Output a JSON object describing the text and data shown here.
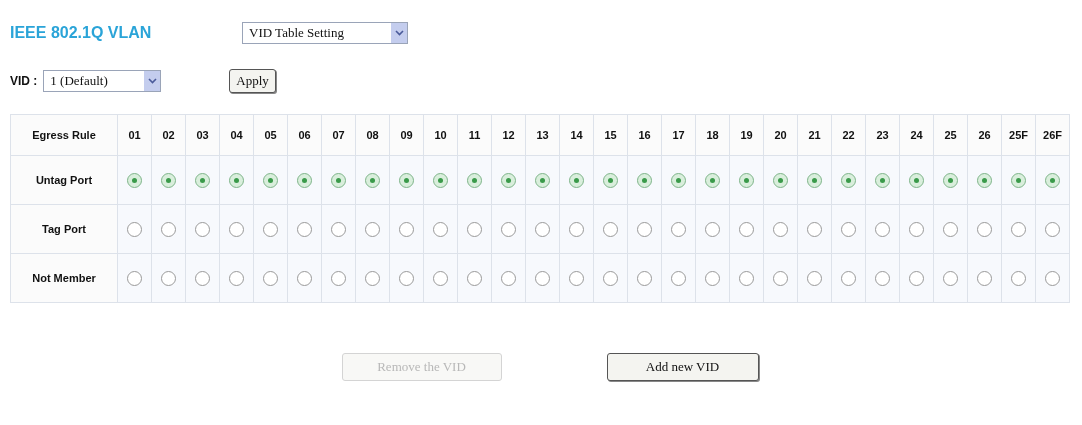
{
  "title": "IEEE 802.1Q VLAN",
  "mode_select": {
    "value": "VID Table Setting"
  },
  "vid": {
    "label": "VID :",
    "value": "1 (Default)"
  },
  "apply_button": {
    "label": "Apply"
  },
  "table": {
    "corner": "Egress Rule",
    "ports": [
      "01",
      "02",
      "03",
      "04",
      "05",
      "06",
      "07",
      "08",
      "09",
      "10",
      "11",
      "12",
      "13",
      "14",
      "15",
      "16",
      "17",
      "18",
      "19",
      "20",
      "21",
      "22",
      "23",
      "24",
      "25",
      "26",
      "25F",
      "26F"
    ],
    "rows": [
      {
        "label": "Untag Port",
        "cells": [
          {
            "selected": true
          },
          {
            "selected": true
          },
          {
            "selected": true
          },
          {
            "selected": true
          },
          {
            "selected": true
          },
          {
            "selected": true
          },
          {
            "selected": true
          },
          {
            "selected": true
          },
          {
            "selected": true
          },
          {
            "selected": true
          },
          {
            "selected": true
          },
          {
            "selected": true
          },
          {
            "selected": true
          },
          {
            "selected": true
          },
          {
            "selected": true
          },
          {
            "selected": true
          },
          {
            "selected": true
          },
          {
            "selected": true
          },
          {
            "selected": true
          },
          {
            "selected": true
          },
          {
            "selected": true
          },
          {
            "selected": true
          },
          {
            "selected": true
          },
          {
            "selected": true
          },
          {
            "selected": true
          },
          {
            "selected": true
          },
          {
            "selected": true
          },
          {
            "selected": true
          }
        ]
      },
      {
        "label": "Tag Port",
        "cells": [
          {
            "selected": false
          },
          {
            "selected": false
          },
          {
            "selected": false
          },
          {
            "selected": false
          },
          {
            "selected": false
          },
          {
            "selected": false
          },
          {
            "selected": false
          },
          {
            "selected": false
          },
          {
            "selected": false
          },
          {
            "selected": false
          },
          {
            "selected": false
          },
          {
            "selected": false
          },
          {
            "selected": false
          },
          {
            "selected": false
          },
          {
            "selected": false
          },
          {
            "selected": false
          },
          {
            "selected": false
          },
          {
            "selected": false
          },
          {
            "selected": false
          },
          {
            "selected": false
          },
          {
            "selected": false
          },
          {
            "selected": false
          },
          {
            "selected": false
          },
          {
            "selected": false
          },
          {
            "selected": false
          },
          {
            "selected": false
          },
          {
            "selected": false
          },
          {
            "selected": false
          }
        ]
      },
      {
        "label": "Not Member",
        "cells": [
          {
            "selected": false
          },
          {
            "selected": false
          },
          {
            "selected": false
          },
          {
            "selected": false
          },
          {
            "selected": false
          },
          {
            "selected": false
          },
          {
            "selected": false
          },
          {
            "selected": false
          },
          {
            "selected": false
          },
          {
            "selected": false
          },
          {
            "selected": false
          },
          {
            "selected": false
          },
          {
            "selected": false
          },
          {
            "selected": false
          },
          {
            "selected": false
          },
          {
            "selected": false
          },
          {
            "selected": false
          },
          {
            "selected": false
          },
          {
            "selected": false
          },
          {
            "selected": false
          },
          {
            "selected": false
          },
          {
            "selected": false
          },
          {
            "selected": false
          },
          {
            "selected": false
          },
          {
            "selected": false
          },
          {
            "selected": false
          },
          {
            "selected": false
          },
          {
            "selected": false
          }
        ]
      }
    ]
  },
  "buttons": [
    {
      "label": "Remove the VID",
      "disabled": true
    },
    {
      "label": "Add new VID",
      "disabled": false
    }
  ]
}
